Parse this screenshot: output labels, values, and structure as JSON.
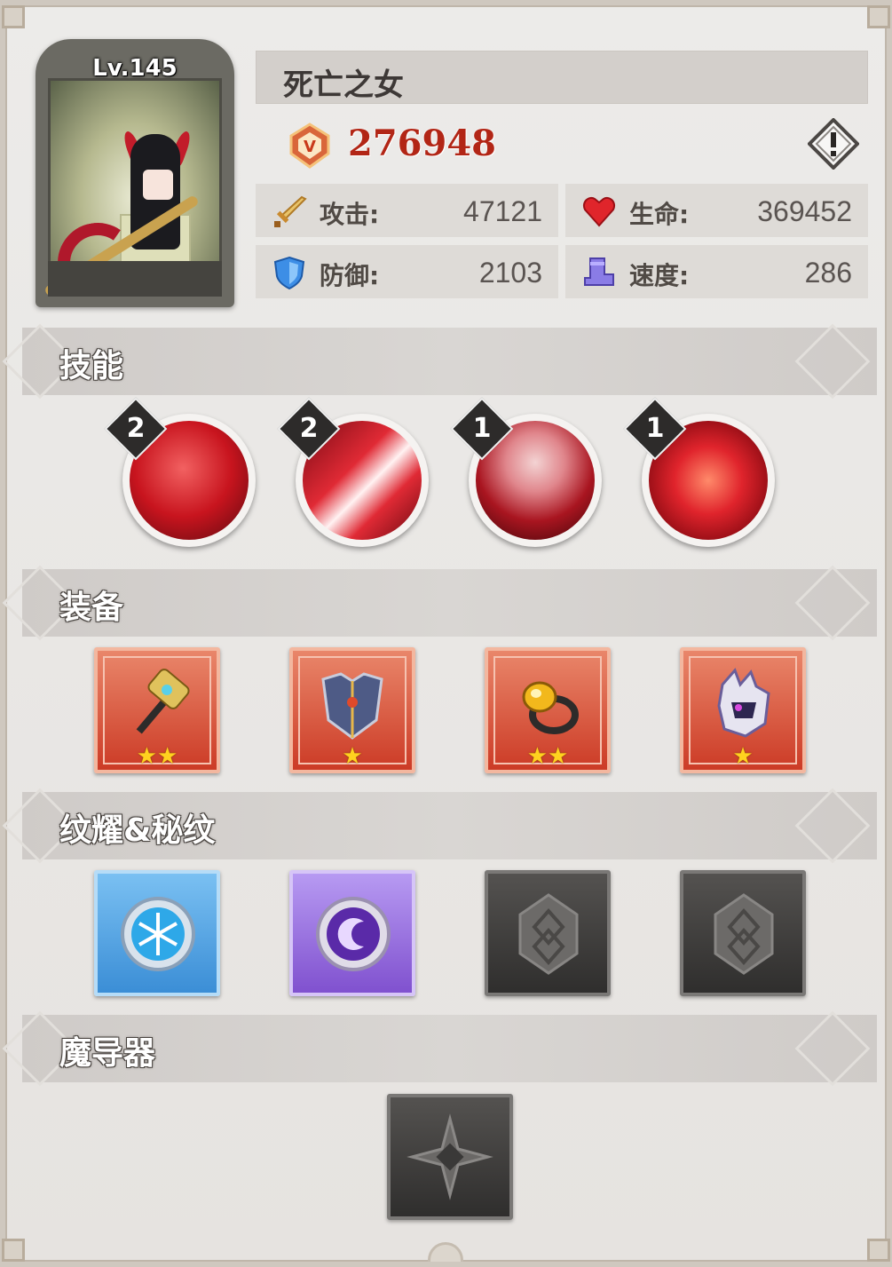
{
  "hero": {
    "level": "Lv.145",
    "name": "死亡之女",
    "power": "276948"
  },
  "stats": [
    {
      "icon": "sword-icon",
      "label": "攻击:",
      "value": "47121"
    },
    {
      "icon": "heart-icon",
      "label": "生命:",
      "value": "369452"
    },
    {
      "icon": "shield-icon",
      "label": "防御:",
      "value": "2103"
    },
    {
      "icon": "boot-icon",
      "label": "速度:",
      "value": "286"
    }
  ],
  "sections": {
    "skills": "技能",
    "equipment": "装备",
    "runes": "纹耀&秘纹",
    "magic_device": "魔导器"
  },
  "skills": [
    {
      "level": "2",
      "icon": "hooded-figure-skill-icon"
    },
    {
      "level": "2",
      "icon": "red-slash-skill-icon"
    },
    {
      "level": "1",
      "icon": "blood-moon-skill-icon"
    },
    {
      "level": "1",
      "icon": "demon-face-skill-icon"
    }
  ],
  "equipment": [
    {
      "icon": "hammer-icon",
      "stars": "★★"
    },
    {
      "icon": "armor-icon",
      "stars": "★"
    },
    {
      "icon": "ring-icon",
      "stars": "★★"
    },
    {
      "icon": "helmet-icon",
      "stars": "★"
    }
  ],
  "runes": [
    {
      "icon": "snowflake-emblem-icon",
      "color": "blue"
    },
    {
      "icon": "crescent-emblem-icon",
      "color": "purple"
    },
    {
      "icon": "locked-rune-icon",
      "color": "gray"
    },
    {
      "icon": "locked-rune-icon",
      "color": "gray"
    }
  ],
  "colors": {
    "power_text": "#b22616",
    "background": "#e9e6e3",
    "header": "#d3cfcb"
  }
}
